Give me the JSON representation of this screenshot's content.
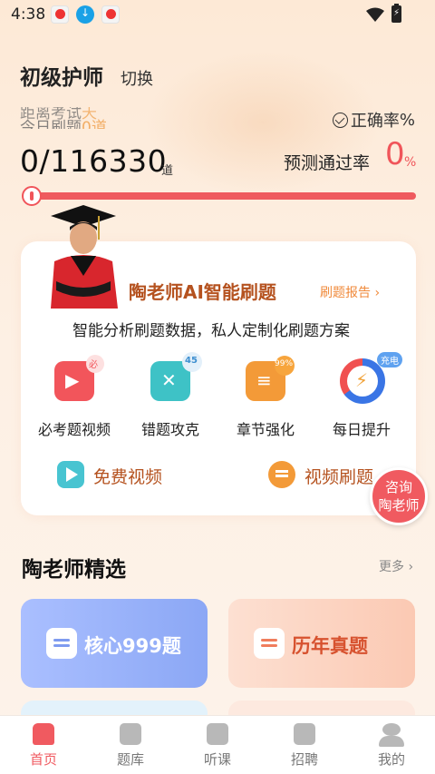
{
  "status_bar": {
    "time": "4:38",
    "notification_icons": [
      "app-notification-icon",
      "download-icon",
      "app-notification-icon"
    ],
    "wifi_icon": "wifi-icon",
    "battery_icon": "battery-charging-icon"
  },
  "header": {
    "title": "初级护师",
    "switch_label": "切换"
  },
  "ticker": {
    "line1_prefix": "距离考试",
    "line1_highlight": "天",
    "line2_prefix": "今日刷题",
    "line2_value": "0",
    "line2_suffix": "道"
  },
  "stats": {
    "accuracy_label": "正确率",
    "accuracy_unit": "%",
    "progress_count": "0/116330",
    "progress_unit": "道",
    "progress_fraction": 0,
    "pass_rate_label": "预测通过率",
    "pass_rate_value": "0",
    "pass_rate_unit": "%"
  },
  "ai_card": {
    "title": "陶老师AI智能刷题",
    "report_link": "刷题报告 ›",
    "subtitle": "智能分析刷题数据，私人定制化刷题方案",
    "features": [
      {
        "label": "必考题视频",
        "badge": "必",
        "icon": "video-icon"
      },
      {
        "label": "错题攻克",
        "badge": "45",
        "icon": "wrong-question-icon"
      },
      {
        "label": "章节强化",
        "badge": "99%",
        "icon": "chapter-icon"
      },
      {
        "label": "每日提升",
        "badge": "充电",
        "icon": "charge-ring-icon"
      }
    ],
    "links": [
      {
        "label": "免费视频",
        "icon": "play-icon"
      },
      {
        "label": "视频刷题",
        "icon": "video-quiz-icon"
      }
    ]
  },
  "consult_button": {
    "line1": "咨询",
    "line2": "陶老师"
  },
  "selection": {
    "title": "陶老师精选",
    "more_label": "更多 ›",
    "cards": [
      {
        "label": "核心999题",
        "icon": "list-icon"
      },
      {
        "label": "历年真题",
        "icon": "list-icon"
      }
    ]
  },
  "bottom_nav": [
    {
      "label": "首页",
      "icon": "home-icon",
      "active": true
    },
    {
      "label": "题库",
      "icon": "question-bank-icon",
      "active": false
    },
    {
      "label": "听课",
      "icon": "book-icon",
      "active": false
    },
    {
      "label": "招聘",
      "icon": "job-icon",
      "active": false
    },
    {
      "label": "我的",
      "icon": "profile-icon",
      "active": false
    }
  ],
  "colors": {
    "accent": "#f05a60",
    "brand_brown": "#b5521f",
    "orange": "#f39a38",
    "teal": "#3ec2c6",
    "blue_card": "#8ba7f5",
    "peach_card": "#fbc9b3"
  }
}
